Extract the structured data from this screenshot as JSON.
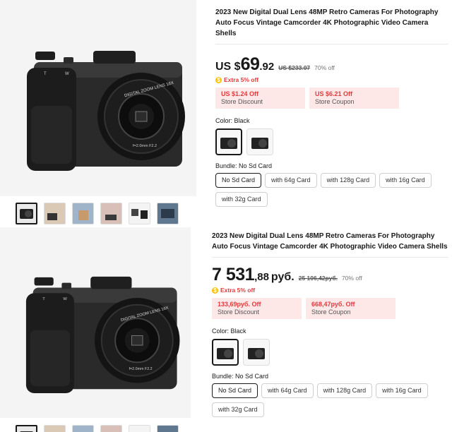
{
  "panels": [
    {
      "title": "2023 New Digital Dual Lens 48MP Retro Cameras For Photography Auto Focus Vintage Camcorder 4K Photographic Video Camera Shells",
      "price": {
        "prefix": "US $",
        "main": "69",
        "decimal": ".92",
        "currency": "",
        "original": "US $233.07",
        "discount": "70% off"
      },
      "extra_label": "Extra 5% off",
      "coupons": [
        {
          "amount": "US $1.24 Off",
          "label": "Store Discount"
        },
        {
          "amount": "US $6.21 Off",
          "label": "Store Coupon"
        }
      ],
      "color_label": "Color: Black",
      "bundle_label": "Bundle: No Sd Card",
      "bundles": [
        "No Sd Card",
        "with 64g Card",
        "with 128g Card",
        "with 16g Card",
        "with 32g Card"
      ]
    },
    {
      "title": "2023 New Digital Dual Lens 48MP Retro Cameras For Photography Auto Focus Vintage Camcorder 4K Photographic Video Camera Shells",
      "price": {
        "prefix": "",
        "main": "7 531",
        "decimal": ",88",
        "currency": "руб.",
        "original": "25 106,42руб.",
        "discount": "70% off"
      },
      "extra_label": "Extra 5% off",
      "coupons": [
        {
          "amount": "133,69руб. Off",
          "label": "Store Discount"
        },
        {
          "amount": "668,47руб. Off",
          "label": "Store Coupon"
        }
      ],
      "color_label": "Color: Black",
      "bundle_label": "Bundle: No Sd Card",
      "bundles": [
        "No Sd Card",
        "with 64g Card",
        "with 128g Card",
        "with 16g Card",
        "with 32g Card"
      ]
    }
  ],
  "camera_lens_text": "DIGITAL ZOOM LENS 16X",
  "camera_lens_spec": "f=2.0mm F2.2",
  "camera_dial_labels": [
    "T",
    "W"
  ],
  "icons": {
    "extra_badge": "coin-icon",
    "product_image": "camera-image"
  },
  "colors": {
    "price_red": "#e4393c",
    "coupon_bg": "#fde7e7",
    "coin": "#ffc000"
  }
}
